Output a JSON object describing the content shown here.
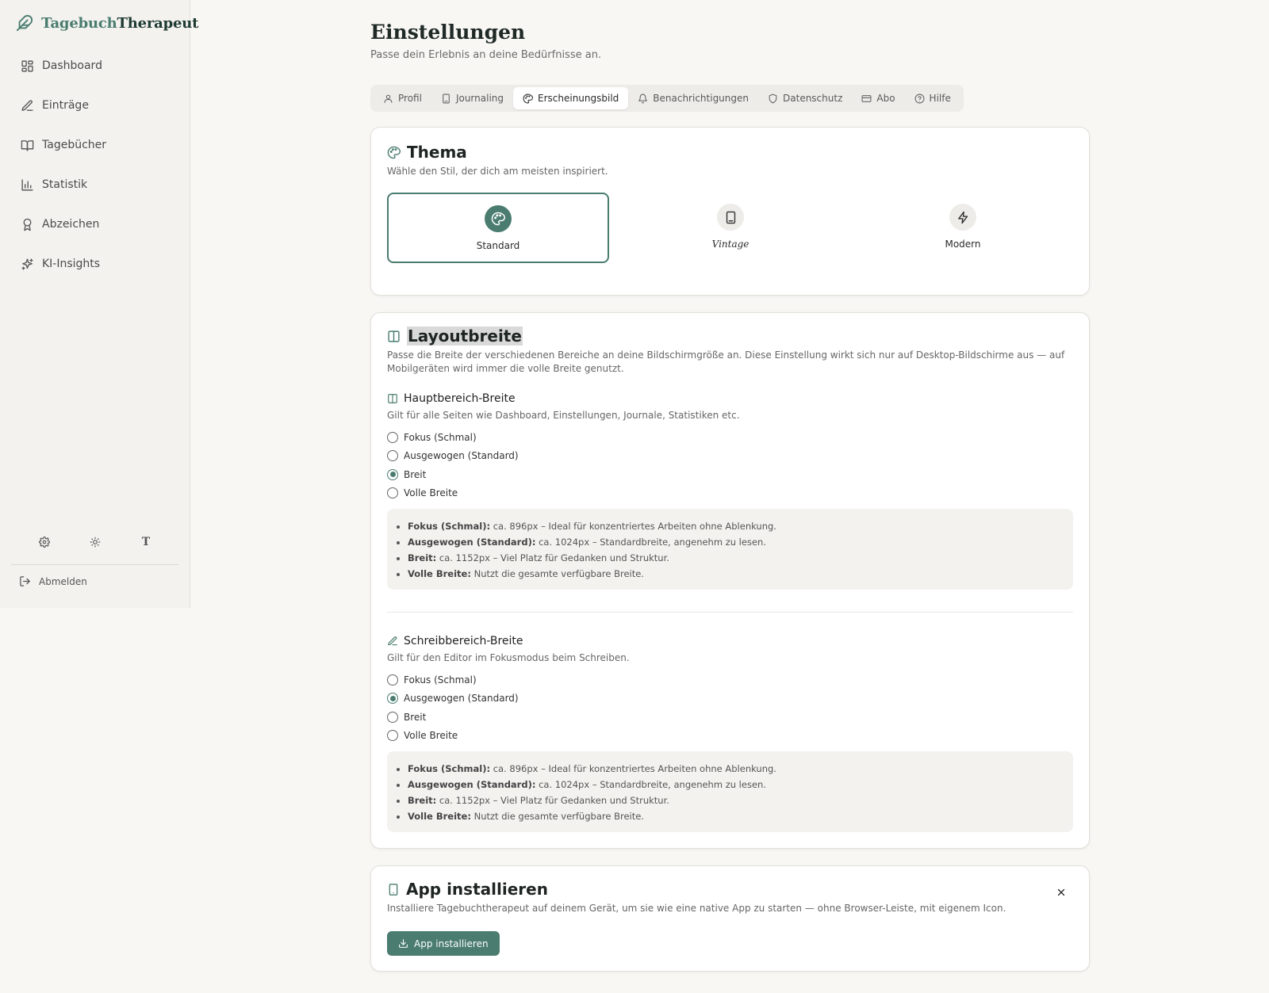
{
  "brand": {
    "part1": "Tagebuch",
    "part2": "Therapeut"
  },
  "sidebar": {
    "items": [
      {
        "label": "Dashboard",
        "icon": "dashboard-icon"
      },
      {
        "label": "Einträge",
        "icon": "pencil-icon"
      },
      {
        "label": "Tagebücher",
        "icon": "book-icon"
      },
      {
        "label": "Statistik",
        "icon": "bar-chart-icon"
      },
      {
        "label": "Abzeichen",
        "icon": "award-icon"
      },
      {
        "label": "KI-Insights",
        "icon": "sparkles-icon"
      }
    ],
    "tools": {
      "settings": "gear-icon",
      "theme": "sun-icon",
      "font": "T"
    },
    "logout": "Abmelden"
  },
  "page": {
    "title": "Einstellungen",
    "subtitle": "Passe dein Erlebnis an deine Bedürfnisse an."
  },
  "tabs": [
    {
      "label": "Profil",
      "icon": "user-icon",
      "active": false
    },
    {
      "label": "Journaling",
      "icon": "notebook-icon",
      "active": false
    },
    {
      "label": "Erscheinungsbild",
      "icon": "palette-icon",
      "active": true
    },
    {
      "label": "Benachrichtigungen",
      "icon": "bell-icon",
      "active": false
    },
    {
      "label": "Datenschutz",
      "icon": "shield-icon",
      "active": false
    },
    {
      "label": "Abo",
      "icon": "credit-card-icon",
      "active": false
    },
    {
      "label": "Hilfe",
      "icon": "help-circle-icon",
      "active": false
    }
  ],
  "theme": {
    "title": "Thema",
    "description": "Wähle den Stil, der dich am meisten inspiriert.",
    "options": [
      {
        "label": "Standard",
        "icon": "palette-icon",
        "selected": true
      },
      {
        "label": "Vintage",
        "icon": "notebook-icon",
        "selected": false
      },
      {
        "label": "Modern",
        "icon": "lightning-icon",
        "selected": false
      }
    ]
  },
  "layout": {
    "title": "Layoutbreite",
    "description": "Passe die Breite der verschiedenen Bereiche an deine Bildschirmgröße an. Diese Einstellung wirkt sich nur auf Desktop-Bildschirme aus — auf Mobilgeräten wird immer die volle Breite genutzt.",
    "main": {
      "title": "Hauptbereich-Breite",
      "description": "Gilt für alle Seiten wie Dashboard, Einstellungen, Journale, Statistiken etc.",
      "options": [
        "Fokus (Schmal)",
        "Ausgewogen (Standard)",
        "Breit",
        "Volle Breite"
      ],
      "selected": "Breit"
    },
    "writing": {
      "title": "Schreibbereich-Breite",
      "description": "Gilt für den Editor im Fokusmodus beim Schreiben.",
      "options": [
        "Fokus (Schmal)",
        "Ausgewogen (Standard)",
        "Breit",
        "Volle Breite"
      ],
      "selected": "Ausgewogen (Standard)"
    },
    "info": [
      {
        "term": "Fokus (Schmal):",
        "text": " ca. 896px – Ideal für konzentriertes Arbeiten ohne Ablenkung."
      },
      {
        "term": "Ausgewogen (Standard):",
        "text": " ca. 1024px – Standardbreite, angenehm zu lesen."
      },
      {
        "term": "Breit:",
        "text": " ca. 1152px – Viel Platz für Gedanken und Struktur."
      },
      {
        "term": "Volle Breite:",
        "text": " Nutzt die gesamte verfügbare Breite."
      }
    ]
  },
  "install": {
    "title": "App installieren",
    "description": "Installiere Tagebuchtherapeut auf deinem Gerät, um sie wie eine native App zu starten — ohne Browser-Leiste, mit eigenem Icon.",
    "button": "App installieren"
  },
  "colors": {
    "accent": "#4a7c6f",
    "background": "#f8f7f4",
    "sidebar": "#f3f2ef"
  }
}
